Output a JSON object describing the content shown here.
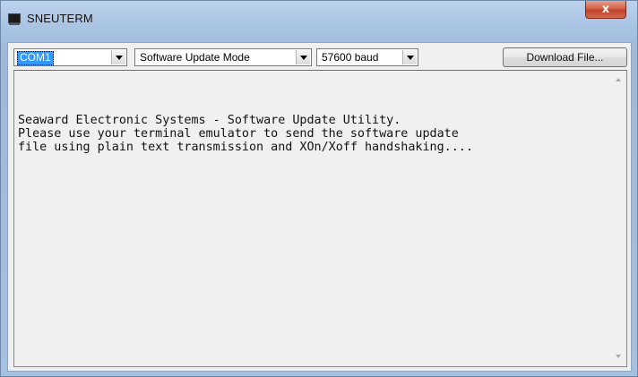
{
  "window": {
    "title": "SNEUTERM",
    "close_glyph": "x",
    "app_icon": "terminal-window-icon"
  },
  "toolbar": {
    "port": {
      "value": "COM1"
    },
    "mode": {
      "value": "Software Update Mode"
    },
    "baud": {
      "value": "57600 baud"
    },
    "download_label": "Download File..."
  },
  "terminal": {
    "lines": [
      "Seaward Electronic Systems - Software Update Utility.",
      "Please use your terminal emulator to send the software update",
      "file using plain text transmission and XOn/Xoff handshaking...."
    ]
  },
  "colors": {
    "selection": "#3399ff",
    "close_button": "#c2412a",
    "client_background": "#f0f0f0"
  }
}
